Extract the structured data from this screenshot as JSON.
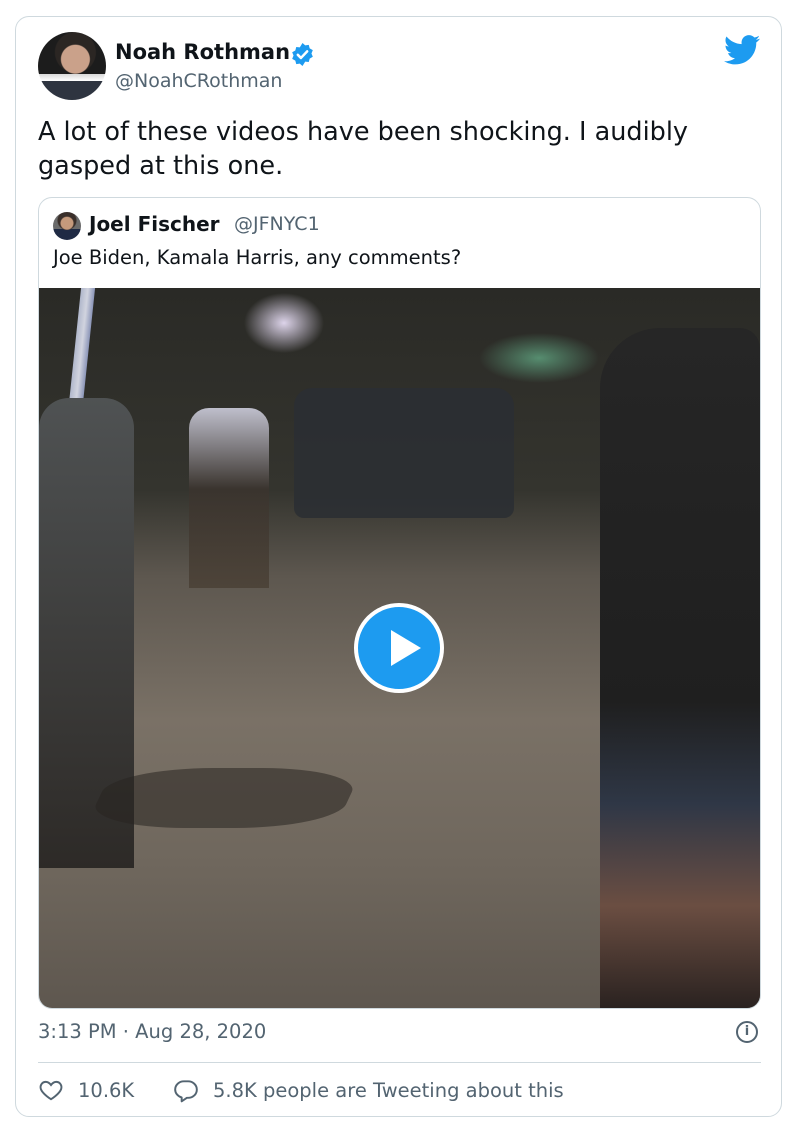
{
  "author": {
    "name": "Noah Rothman",
    "handle": "@NoahCRothman"
  },
  "tweet": {
    "text": "A lot of these videos have been shocking. I audibly gasped at this one.",
    "timestamp": "3:13 PM · Aug 28, 2020"
  },
  "quoted": {
    "name": "Joel Fischer",
    "handle": "@JFNYC1",
    "text": "Joe Biden, Kamala Harris, any comments?"
  },
  "actions": {
    "likes": "10.6K",
    "replies_text": "5.8K people are Tweeting about this"
  },
  "colors": {
    "accent": "#1d9bf0",
    "secondary_text": "#536471",
    "border": "#cfd9de"
  },
  "icons": [
    "twitter-bird-icon",
    "verified-badge-icon",
    "play-icon",
    "info-icon",
    "heart-icon",
    "reply-bubble-icon"
  ]
}
